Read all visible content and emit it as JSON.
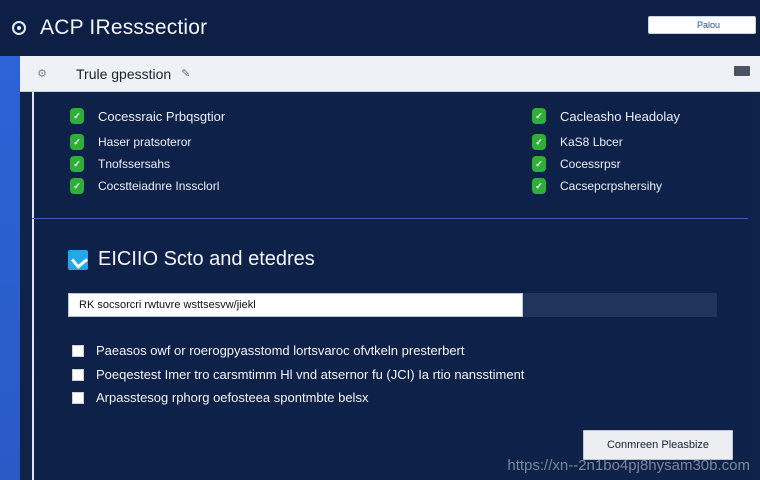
{
  "app": {
    "title": "ACP IResssectior",
    "top_field_value": "Palou"
  },
  "window": {
    "header_title": "Trule gpesstion"
  },
  "checks": {
    "left": [
      {
        "label": "Cocessraic Prbqsgtior"
      },
      {
        "label": "Haser pratsoteror"
      },
      {
        "label": "Tnofssersahs"
      },
      {
        "label": "Cocstteiadnre Inssclorl"
      }
    ],
    "right": [
      {
        "label": "Cacleasho Headolay"
      },
      {
        "label": "KaS8 Lbcer"
      },
      {
        "label": "Cocessrpsr"
      },
      {
        "label": "Cacsepcrpshersihy"
      }
    ]
  },
  "section": {
    "title": "EICIIO Scto and etedres",
    "input_value": "RK socsorcri rwtuvre wsttsesvw/jiekl"
  },
  "options": [
    {
      "label": "Paeasos owf or roerogpyasstomd lortsvaroc ofvtkeln presterbert"
    },
    {
      "label": "Poeqestest Imer tro carsmtimm Hl vnd atsernor fu (JCI) Ia rtio nansstiment"
    },
    {
      "label": "Arpasstesog rphorg oefosteea spontmbte belsx"
    }
  ],
  "actions": {
    "primary_label": "Conmreen Pleasbize"
  },
  "watermark": "https://xn--2n1bo4pj8hysam30b.com",
  "colors": {
    "accent_blue": "#2c63d6",
    "panel_bg": "#0e2148",
    "success_green": "#2fae3a",
    "info_blue": "#22a7ea"
  },
  "icons": {
    "app": "app-logo-icon",
    "header": "gear-icon",
    "edit": "pencil-icon",
    "window_control": "minimize-icon",
    "check": "check-icon",
    "info": "info-icon"
  }
}
